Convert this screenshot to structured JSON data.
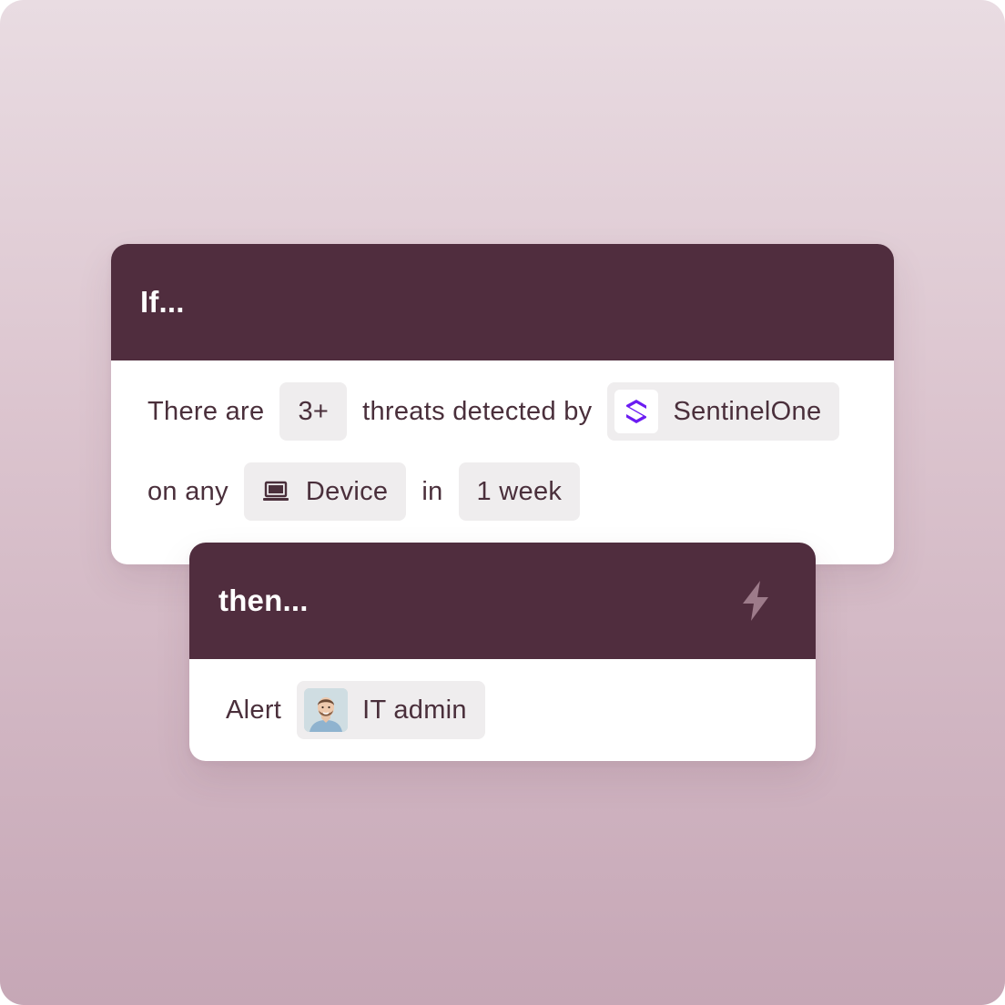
{
  "if_card": {
    "title": "If...",
    "row1": {
      "prefix": "There are",
      "count_chip": "3+",
      "middle": "threats detected by",
      "source_chip": "SentinelOne",
      "source_icon": "sentinelone-logo-icon"
    },
    "row2": {
      "prefix": "on any",
      "device_chip": "Device",
      "device_icon": "laptop-icon",
      "middle": "in",
      "period_chip": "1 week"
    }
  },
  "then_card": {
    "title": "then...",
    "header_icon": "lightning-bolt-icon",
    "row1": {
      "prefix": "Alert",
      "recipient_chip": "IT admin",
      "recipient_icon": "avatar"
    }
  },
  "colors": {
    "header_bg": "#502d3e",
    "chip_bg": "#efedee",
    "text": "#4a2f3b",
    "accent_logo": "#6b1bf2",
    "bolt": "#9d7b8a"
  }
}
